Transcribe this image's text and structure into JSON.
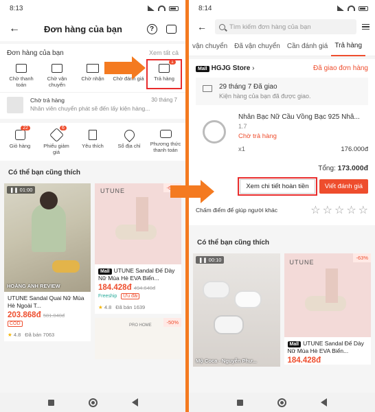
{
  "left": {
    "status_time": "8:13",
    "title": "Đơn hàng của bạn",
    "orders_label": "Đơn hàng của bạn",
    "see_all": "Xem tất cả",
    "order_statuses": [
      {
        "label": "Chờ thanh toán",
        "icon": "wallet-icon"
      },
      {
        "label": "Chờ vận chuyển",
        "icon": "box-icon"
      },
      {
        "label": "Chờ nhận",
        "icon": "truck-icon"
      },
      {
        "label": "Chờ đánh giá",
        "icon": "star-icon"
      },
      {
        "label": "Trả hàng",
        "icon": "return-icon",
        "badge": "1"
      }
    ],
    "tracking": {
      "status": "Chờ trả hàng",
      "date": "30 tháng 7",
      "message": "Nhân viên chuyển phát sẽ đến lấy kiện hàng..."
    },
    "tools": [
      {
        "label": "Giỏ hàng",
        "badge": "22",
        "icon": "cart-icon"
      },
      {
        "label": "Phiếu giảm giá",
        "badge": "6",
        "icon": "voucher-icon"
      },
      {
        "label": "Yêu thích",
        "icon": "bookmark-icon"
      },
      {
        "label": "Sổ địa chỉ",
        "icon": "location-icon"
      },
      {
        "label": "Phương thức thanh toán",
        "icon": "card-icon"
      }
    ],
    "recommend_title": "Có thể bạn cũng thích",
    "products": [
      {
        "video": "01:00",
        "overlay": "HOÀNG ANH REVIEW",
        "name": "UTUNE Sandal Quai Nữ Mùa Hè Ngoài T...",
        "price": "203.868đ",
        "old_price": "581.040đ",
        "tag": "COD",
        "rating": "4.8",
        "sold": "Đã bán 7063"
      },
      {
        "discount": "-63%",
        "brand": "UTUNE",
        "mall": "Mall",
        "name": "UTUNE Sandal Đế Dày Nữ Mùa Hè EVA Biển...",
        "price": "184.428đ",
        "old_price": "494.640đ",
        "ship": "Freeship",
        "promo": "Ưu đãi",
        "rating": "4.8",
        "sold": "Đã bán 1639"
      },
      {
        "discount": "-50%",
        "brand": "PRO HOME"
      }
    ]
  },
  "right": {
    "status_time": "8:14",
    "search_placeholder": "Tìm kiếm đơn hàng của bạn",
    "tabs": [
      "vận chuyển",
      "Đã vận chuyển",
      "Cần đánh giá",
      "Trả hàng"
    ],
    "active_tab": 3,
    "store": {
      "mall": "Mall",
      "name": "HGJG Store",
      "status": "Đã giao đơn hàng",
      "delivery_date": "29 tháng 7 Đã giao",
      "delivery_msg": "Kiện hàng của bạn đã được giao.",
      "product_name": "Nhẫn Bạc Nữ Cầu Vồng Bạc 925 Nhẫ...",
      "variant": "1.7",
      "return_status": "Chờ trả hàng",
      "qty": "x1",
      "price": "176.000đ",
      "total_label": "Tổng:",
      "total": "173.000đ",
      "refund_btn": "Xem chi tiết hoàn tiền",
      "review_btn": "Viết đánh giá",
      "rate_prompt": "Chấm điểm để giúp người khác"
    },
    "recommend_title": "Có thể bạn cũng thích",
    "products": [
      {
        "video": "00:10",
        "overlay": "Mộ Coca - Nguyễn Phư..."
      },
      {
        "discount": "-63%",
        "brand": "UTUNE",
        "mall": "Mall",
        "name": "UTUNE Sandal Đế Dày Nữ Mùa Hè EVA Biển...",
        "price": "184.428đ"
      }
    ]
  }
}
